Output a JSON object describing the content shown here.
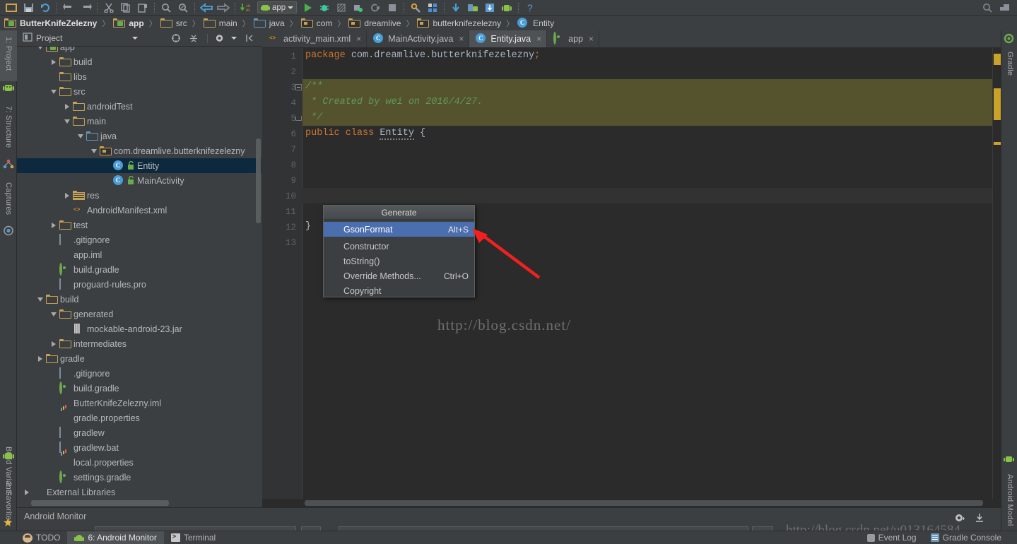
{
  "toolbar": {
    "icons": [
      "open-project-icon",
      "save-all-icon",
      "sync-icon",
      "undo-icon",
      "redo-icon",
      "cut-icon",
      "copy-icon",
      "paste-icon",
      "find-icon",
      "find-replace-icon",
      "back-icon",
      "forward-icon",
      "compile-icon"
    ],
    "module_selector": "app",
    "run_icons": [
      "run-icon",
      "debug-icon",
      "coverage-icon",
      "attach-debugger-icon",
      "rerun-icon",
      "stop-icon",
      "sdk-manager-icon",
      "avd-manager-icon",
      "sync-gradle-icon",
      "android-device-monitor-icon",
      "download-icon",
      "android-icon",
      "help-icon"
    ],
    "right_icons": [
      "search-everywhere-icon",
      "layout-icon"
    ]
  },
  "breadcrumb": {
    "items": [
      {
        "label": "ButterKnifeZelezny",
        "icon": "module-icon",
        "bold": true
      },
      {
        "label": "app",
        "icon": "module-icon",
        "bold": true
      },
      {
        "label": "src",
        "icon": "folder-icon",
        "bold": false
      },
      {
        "label": "main",
        "icon": "folder-icon",
        "bold": false
      },
      {
        "label": "java",
        "icon": "source-folder-icon",
        "bold": false
      },
      {
        "label": "com",
        "icon": "package-icon",
        "bold": false
      },
      {
        "label": "dreamlive",
        "icon": "package-icon",
        "bold": false
      },
      {
        "label": "butterknifezelezny",
        "icon": "package-icon",
        "bold": false
      },
      {
        "label": "Entity",
        "icon": "class-icon",
        "bold": false
      }
    ]
  },
  "left_tool_strip": [
    {
      "label": "1: Project",
      "icon": "android-project-icon",
      "selected": true
    },
    {
      "label": "7: Structure",
      "icon": "structure-icon",
      "selected": false
    },
    {
      "label": "Captures",
      "icon": "captures-icon",
      "selected": false
    },
    {
      "label": "Build Variants",
      "icon": "build-variants-icon",
      "selected": false
    },
    {
      "label": "2: Favorites",
      "icon": "favorites-star-icon",
      "selected": false
    }
  ],
  "right_tool_strip": [
    {
      "label": "Gradle",
      "icon": "gradle-icon"
    },
    {
      "label": "Android Model",
      "icon": "android-model-icon"
    }
  ],
  "project_panel": {
    "title": "Project",
    "toolbar_icons": [
      "target-icon",
      "collapse-all-icon",
      "settings-gear-icon",
      "hide-icon"
    ],
    "tree": [
      {
        "depth": 2,
        "label": "app",
        "icon": "module-icon",
        "twisty": "down",
        "partial": true
      },
      {
        "depth": 3,
        "label": "build",
        "icon": "folder-icon",
        "twisty": "right"
      },
      {
        "depth": 3,
        "label": "libs",
        "icon": "folder-icon",
        "twisty": "none"
      },
      {
        "depth": 3,
        "label": "src",
        "icon": "folder-icon",
        "twisty": "down"
      },
      {
        "depth": 4,
        "label": "androidTest",
        "icon": "folder-icon",
        "twisty": "right"
      },
      {
        "depth": 4,
        "label": "main",
        "icon": "folder-icon",
        "twisty": "down"
      },
      {
        "depth": 5,
        "label": "java",
        "icon": "source-folder-icon",
        "twisty": "down"
      },
      {
        "depth": 6,
        "label": "com.dreamlive.butterknifezelezny",
        "icon": "package-icon",
        "twisty": "down"
      },
      {
        "depth": 7,
        "label": "Entity",
        "icon": "class-icon",
        "twisty": "none",
        "selected": true,
        "lock": true
      },
      {
        "depth": 7,
        "label": "MainActivity",
        "icon": "class-icon",
        "twisty": "none",
        "lock": true
      },
      {
        "depth": 4,
        "label": "res",
        "icon": "res-folder-icon",
        "twisty": "right"
      },
      {
        "depth": 4,
        "label": "AndroidManifest.xml",
        "icon": "xml-file-icon",
        "twisty": "none"
      },
      {
        "depth": 3,
        "label": "test",
        "icon": "folder-icon",
        "twisty": "right"
      },
      {
        "depth": 3,
        "label": ".gitignore",
        "icon": "text-file-icon",
        "twisty": "none"
      },
      {
        "depth": 3,
        "label": "app.iml",
        "icon": "iml-file-icon",
        "twisty": "none"
      },
      {
        "depth": 3,
        "label": "build.gradle",
        "icon": "gradle-file-icon",
        "twisty": "none"
      },
      {
        "depth": 3,
        "label": "proguard-rules.pro",
        "icon": "text-file-icon",
        "twisty": "none"
      },
      {
        "depth": 2,
        "label": "build",
        "icon": "folder-icon",
        "twisty": "down"
      },
      {
        "depth": 3,
        "label": "generated",
        "icon": "folder-icon",
        "twisty": "down"
      },
      {
        "depth": 4,
        "label": "mockable-android-23.jar",
        "icon": "jar-file-icon",
        "twisty": "none"
      },
      {
        "depth": 3,
        "label": "intermediates",
        "icon": "folder-icon",
        "twisty": "right"
      },
      {
        "depth": 2,
        "label": "gradle",
        "icon": "folder-icon",
        "twisty": "right"
      },
      {
        "depth": 3,
        "label": ".gitignore",
        "icon": "text-file-icon",
        "twisty": "none"
      },
      {
        "depth": 3,
        "label": "build.gradle",
        "icon": "gradle-file-icon",
        "twisty": "none"
      },
      {
        "depth": 3,
        "label": "ButterKnifeZelezny.iml",
        "icon": "iml-file-icon",
        "twisty": "none"
      },
      {
        "depth": 3,
        "label": "gradle.properties",
        "icon": "properties-file-icon",
        "twisty": "none"
      },
      {
        "depth": 3,
        "label": "gradlew",
        "icon": "text-file-icon",
        "twisty": "none"
      },
      {
        "depth": 3,
        "label": "gradlew.bat",
        "icon": "text-file-icon",
        "twisty": "none"
      },
      {
        "depth": 3,
        "label": "local.properties",
        "icon": "properties-file-icon",
        "twisty": "none"
      },
      {
        "depth": 3,
        "label": "settings.gradle",
        "icon": "gradle-file-icon",
        "twisty": "none"
      },
      {
        "depth": 1,
        "label": "External Libraries",
        "icon": "libraries-icon",
        "twisty": "right"
      }
    ]
  },
  "editor": {
    "tabs": [
      {
        "label": "activity_main.xml",
        "icon": "xml-file-icon",
        "active": false
      },
      {
        "label": "MainActivity.java",
        "icon": "class-icon",
        "active": false
      },
      {
        "label": "Entity.java",
        "icon": "class-icon",
        "active": true
      },
      {
        "label": "app",
        "icon": "gradle-file-icon",
        "active": false
      }
    ],
    "line_numbers": [
      "1",
      "2",
      "3",
      "4",
      "5",
      "6",
      "7",
      "8",
      "9",
      "10",
      "11",
      "12",
      "13"
    ],
    "code": [
      {
        "n": 1,
        "tokens": [
          {
            "t": "package ",
            "c": "kw"
          },
          {
            "t": "com.dreamlive.butterknifezelezny",
            "c": "plain"
          },
          {
            "t": ";",
            "c": "semi"
          }
        ]
      },
      {
        "n": 2,
        "tokens": []
      },
      {
        "n": 3,
        "tokens": [
          {
            "t": "/**",
            "c": "cmt"
          }
        ],
        "doc": true
      },
      {
        "n": 4,
        "tokens": [
          {
            "t": " * Created by wei on 2016/4/27.",
            "c": "cmt"
          }
        ],
        "doc": true
      },
      {
        "n": 5,
        "tokens": [
          {
            "t": " */",
            "c": "cmt"
          }
        ],
        "doc": true
      },
      {
        "n": 6,
        "tokens": [
          {
            "t": "public class ",
            "c": "kw"
          },
          {
            "t": "Entity",
            "c": "cls"
          },
          {
            "t": " {",
            "c": "plain"
          }
        ]
      },
      {
        "n": 7,
        "tokens": []
      },
      {
        "n": 8,
        "tokens": []
      },
      {
        "n": 9,
        "tokens": []
      },
      {
        "n": 10,
        "tokens": [],
        "current": true
      },
      {
        "n": 11,
        "tokens": []
      },
      {
        "n": 12,
        "tokens": [
          {
            "t": "}",
            "c": "plain"
          }
        ]
      },
      {
        "n": 13,
        "tokens": []
      }
    ],
    "watermark_1": "http://blog.csdn.net/",
    "watermark_2": "http://blog.csdn.net/u013164584"
  },
  "generate_popup": {
    "title": "Generate",
    "items": [
      {
        "label": "GsonFormat",
        "shortcut": "Alt+S",
        "highlighted": true
      },
      {
        "label": "Constructor",
        "shortcut": "",
        "highlighted": false
      },
      {
        "label": "toString()",
        "shortcut": "",
        "highlighted": false
      },
      {
        "label": "Override Methods...",
        "shortcut": "Ctrl+O",
        "highlighted": false
      },
      {
        "label": "Copyright",
        "shortcut": "",
        "highlighted": false
      }
    ]
  },
  "bottom_panel": {
    "title": "Android Monitor",
    "gear_icon": "settings-gear-icon",
    "minimize_icon": "hide-panel-icon"
  },
  "status_bar": {
    "items": [
      {
        "label": "TODO",
        "icon": "todo-icon",
        "selected": false
      },
      {
        "label": "6: Android Monitor",
        "icon": "android-icon",
        "selected": true
      },
      {
        "label": "Terminal",
        "icon": "terminal-icon",
        "selected": false
      }
    ],
    "right_items": [
      {
        "label": "Event Log",
        "icon": "event-log-icon"
      },
      {
        "label": "Gradle Console",
        "icon": "gradle-console-icon"
      }
    ]
  },
  "colors": {
    "background": "#3c3f41",
    "editor_bg": "#2b2b2b",
    "selection": "#0d293e",
    "highlight": "#4b6eaf",
    "keyword": "#cc7832",
    "comment": "#629755",
    "doc_highlight": "#55532e",
    "arrow": "#f42020",
    "marker": "#c9a227"
  }
}
